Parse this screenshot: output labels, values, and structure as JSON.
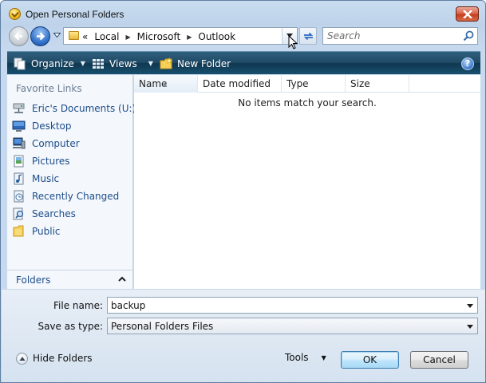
{
  "window": {
    "title": "Open Personal Folders"
  },
  "address_bar": {
    "overflow": "«",
    "breadcrumbs": [
      "Local",
      "Microsoft",
      "Outlook"
    ]
  },
  "search": {
    "placeholder": "Search"
  },
  "toolbar": {
    "organize": "Organize",
    "views": "Views",
    "new_folder": "New Folder",
    "help": "?"
  },
  "favorite_links": {
    "header": "Favorite Links",
    "items": [
      {
        "label": "Eric's Documents (U:)",
        "icon": "network-drive-icon"
      },
      {
        "label": "Desktop",
        "icon": "desktop-icon"
      },
      {
        "label": "Computer",
        "icon": "computer-icon"
      },
      {
        "label": "Pictures",
        "icon": "pictures-icon"
      },
      {
        "label": "Music",
        "icon": "music-icon"
      },
      {
        "label": "Recently Changed",
        "icon": "recently-changed-icon"
      },
      {
        "label": "Searches",
        "icon": "searches-icon"
      },
      {
        "label": "Public",
        "icon": "public-folder-icon"
      }
    ],
    "folders_label": "Folders"
  },
  "file_list": {
    "columns": [
      "Name",
      "Date modified",
      "Type",
      "Size"
    ],
    "sorted_column": "Name",
    "empty_message": "No items match your search."
  },
  "form": {
    "file_name_label": "File name:",
    "file_name_value": "backup",
    "save_as_type_label": "Save as type:",
    "save_as_type_value": "Personal Folders Files"
  },
  "footer": {
    "hide_folders": "Hide Folders",
    "tools": "Tools",
    "ok": "OK",
    "cancel": "Cancel"
  },
  "colors": {
    "toolbar": "#1f4a66",
    "link_text": "#1c4d8b",
    "close_button": "#c63d1e"
  }
}
